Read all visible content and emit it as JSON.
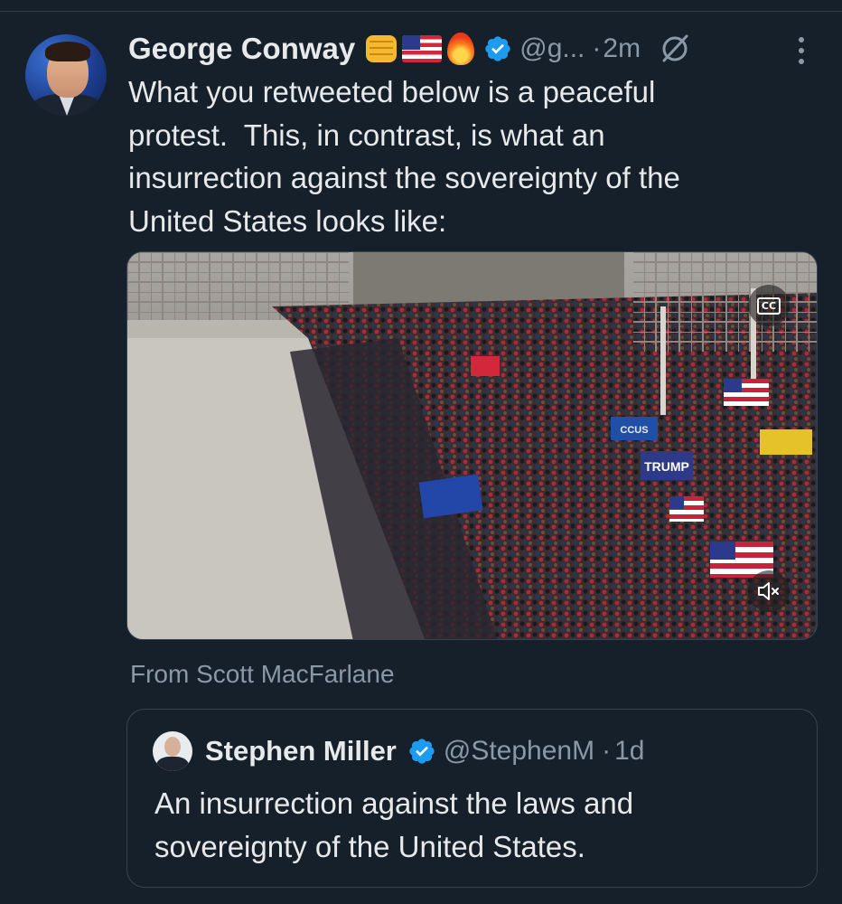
{
  "tweet": {
    "author": {
      "name": "George Conway",
      "handle": "@g...",
      "separator": "·",
      "time": "2m",
      "badges": [
        "oncoming-fist-emoji",
        "us-flag-emoji",
        "fire-emoji",
        "verified-badge-icon"
      ]
    },
    "text_lines": [
      "What you retweeted below is a peaceful",
      "protest.  This, in contrast, is what an",
      "insurrection against the sovereignty of the",
      "United States looks like:"
    ],
    "media": {
      "type": "video",
      "cc_label": "CC",
      "controls": [
        "closed-captions-icon",
        "mute-icon"
      ],
      "sign_text": "TRUMP",
      "banner_text": "CCUS"
    },
    "source_text": "From Scott MacFarlane"
  },
  "quoted_tweet": {
    "name": "Stephen Miller",
    "handle": "@StephenM",
    "separator": "·",
    "time": "1d",
    "text_lines": [
      "An insurrection against the laws and",
      "sovereignty of the United States."
    ]
  },
  "colors": {
    "background": "#15202b",
    "text_primary": "#e7e9ea",
    "text_secondary": "#8b98a5",
    "verified_blue": "#1d9bf0",
    "border": "#38444d"
  }
}
